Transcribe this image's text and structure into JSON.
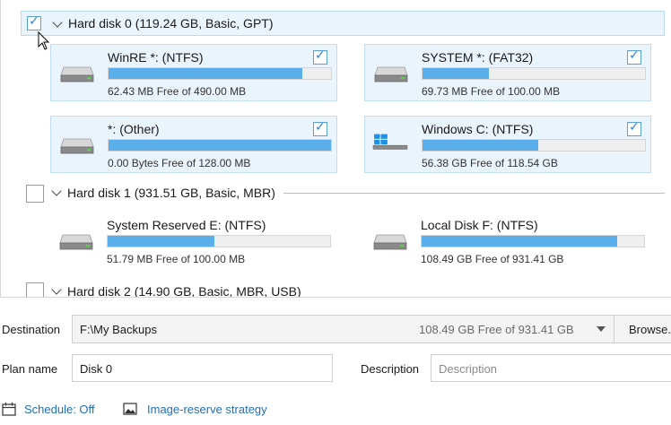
{
  "disks": [
    {
      "title": "Hard disk 0 (119.24 GB, Basic, GPT)",
      "checked": true,
      "partitions": [
        {
          "name": "WinRE *: (NTFS)",
          "free": "62.43 MB Free of 490.00 MB",
          "used_fraction": 0.87,
          "checked": true,
          "icon": "drive-icon"
        },
        {
          "name": "SYSTEM *: (FAT32)",
          "free": "69.73 MB Free of 100.00 MB",
          "used_fraction": 0.3,
          "checked": true,
          "icon": "drive-icon"
        },
        {
          "name": "*: (Other)",
          "free": "0.00 Bytes Free of 128.00 MB",
          "used_fraction": 1.0,
          "checked": true,
          "icon": "drive-icon"
        },
        {
          "name": "Windows C: (NTFS)",
          "free": "56.38 GB Free of 118.54 GB",
          "used_fraction": 0.52,
          "checked": true,
          "icon": "windows-drive-icon"
        }
      ]
    },
    {
      "title": "Hard disk 1 (931.51 GB, Basic, MBR)",
      "checked": false,
      "partitions": [
        {
          "name": "System Reserved E: (NTFS)",
          "free": "51.79 MB Free of 100.00 MB",
          "used_fraction": 0.48,
          "checked": false,
          "icon": "drive-icon"
        },
        {
          "name": "Local Disk F: (NTFS)",
          "free": "108.49 GB Free of 931.41 GB",
          "used_fraction": 0.88,
          "checked": false,
          "icon": "drive-icon"
        }
      ]
    },
    {
      "title": "Hard disk 2 (14.90 GB, Basic, MBR, USB)",
      "checked": false,
      "partitions": []
    }
  ],
  "form": {
    "destination_label": "Destination",
    "destination_value": "F:\\My Backups",
    "destination_free": "108.49 GB Free of 931.41 GB",
    "browse_label": "Browse...",
    "plan_name_label": "Plan name",
    "plan_name_value": "Disk 0",
    "description_label": "Description",
    "description_placeholder": "Description"
  },
  "footer": {
    "schedule_label": "Schedule: Off",
    "image_reserve_label": "Image-reserve strategy"
  },
  "colors": {
    "accent": "#2f7fcf",
    "bar_fill": "#5aaee9",
    "selection_bg": "#eaf4fc"
  }
}
